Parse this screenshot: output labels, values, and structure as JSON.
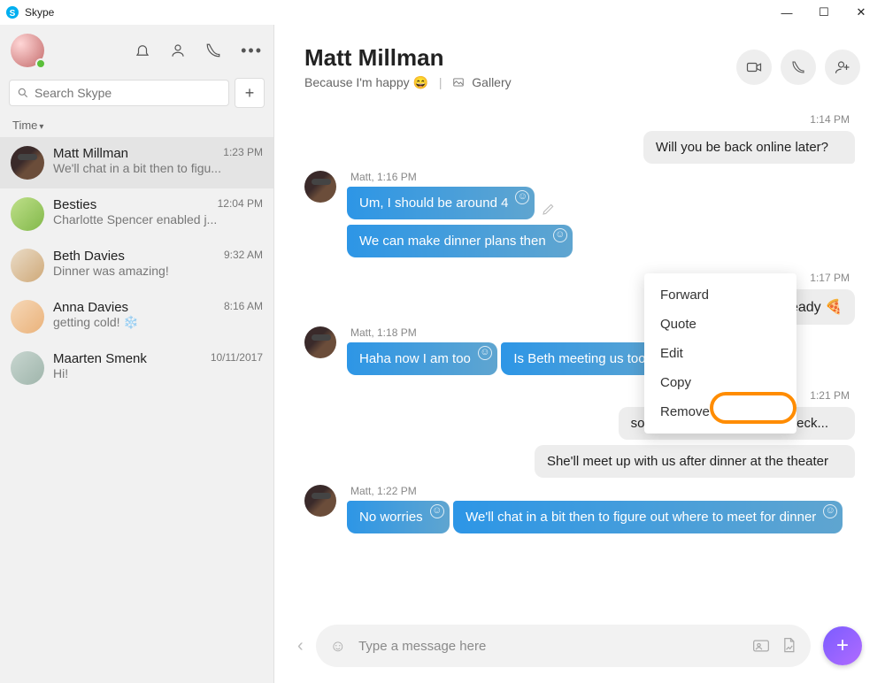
{
  "window": {
    "title": "Skype",
    "minimize": "—",
    "maximize": "☐",
    "close": "✕"
  },
  "sidebar": {
    "search_placeholder": "Search Skype",
    "sort_label": "Time",
    "items": [
      {
        "name": "Matt Millman",
        "preview": "We'll chat in a bit then to figu...",
        "time": "1:23 PM",
        "avatar": "matt",
        "active": true
      },
      {
        "name": "Besties",
        "preview": "Charlotte Spencer enabled j...",
        "time": "12:04 PM",
        "avatar": "besties",
        "active": false
      },
      {
        "name": "Beth Davies",
        "preview": "Dinner was amazing!",
        "time": "9:32 AM",
        "avatar": "beth",
        "active": false
      },
      {
        "name": "Anna Davies",
        "preview": "getting cold! ❄️",
        "time": "8:16 AM",
        "avatar": "anna",
        "active": false
      },
      {
        "name": "Maarten Smenk",
        "preview": "Hi!",
        "time": "10/11/2017",
        "avatar": "maarten",
        "active": false
      }
    ]
  },
  "chat": {
    "title": "Matt Millman",
    "status_prefix": "Because I'm happy",
    "status_emoji": "😄",
    "gallery_label": "Gallery"
  },
  "messages": {
    "ts1": "1:14 PM",
    "out1": "Will you be back online later?",
    "label_in1": "Matt, 1:16 PM",
    "in1a": "Um, I should be around 4",
    "in1b": "We can make dinner plans then",
    "ts2": "1:17 PM",
    "out2_partial": "already 🍕",
    "label_in2": "Matt, 1:18 PM",
    "in2a": "Haha now I am too",
    "in2b": "Is Beth meeting us too?",
    "ts3": "1:21 PM",
    "out3a": "soz I forgot to ask, let me check...",
    "out3b": "She'll meet up with us after dinner at the theater",
    "label_in3": "Matt, 1:22 PM",
    "in3a": "No worries",
    "in3b": "We'll chat in a bit then to figure out where to meet for dinner"
  },
  "context_menu": {
    "forward": "Forward",
    "quote": "Quote",
    "edit": "Edit",
    "copy": "Copy",
    "remove": "Remove"
  },
  "input": {
    "placeholder": "Type a message here"
  }
}
